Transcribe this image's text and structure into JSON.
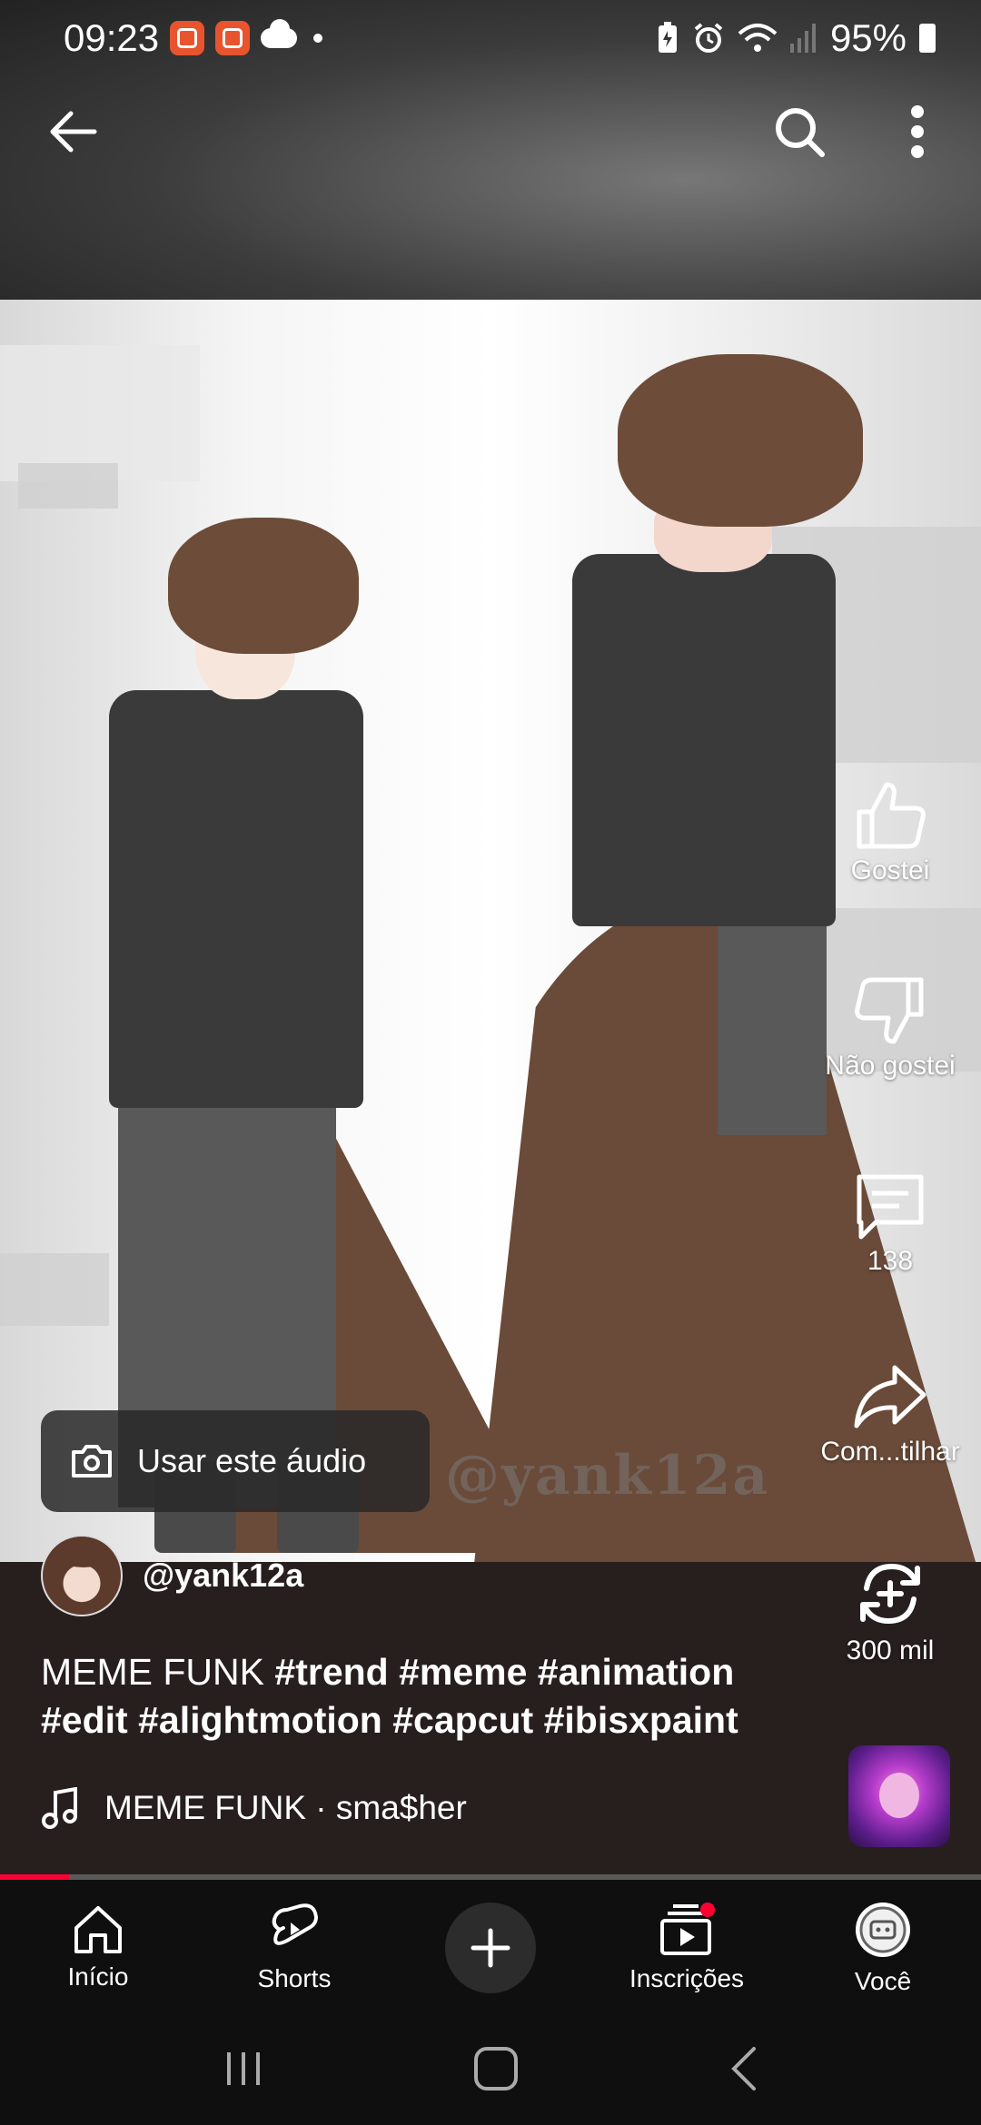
{
  "status_bar": {
    "time": "09:23",
    "battery": "95%"
  },
  "video": {
    "watermark": "@yank12a"
  },
  "actions": {
    "like_label": "Gostei",
    "dislike_label": "Não gostei",
    "comments_count": "138",
    "share_label": "Com...tilhar",
    "remix_count": "300 mil"
  },
  "use_audio": {
    "label": "Usar este áudio"
  },
  "channel": {
    "handle": "@yank12a"
  },
  "description": {
    "title": "MEME FUNK",
    "tags_line1": "#trend #meme #animation",
    "tags_line2": "#edit #alightmotion #capcut #ibisxpaint"
  },
  "music": {
    "label": "MEME FUNK · sma$her"
  },
  "progress": {
    "fraction": 0.07
  },
  "bottom_nav": {
    "home": "Início",
    "shorts": "Shorts",
    "subscriptions": "Inscrições",
    "you": "Você"
  },
  "colors": {
    "accent": "#ff0033",
    "nav_bg": "#0f0f0f"
  }
}
